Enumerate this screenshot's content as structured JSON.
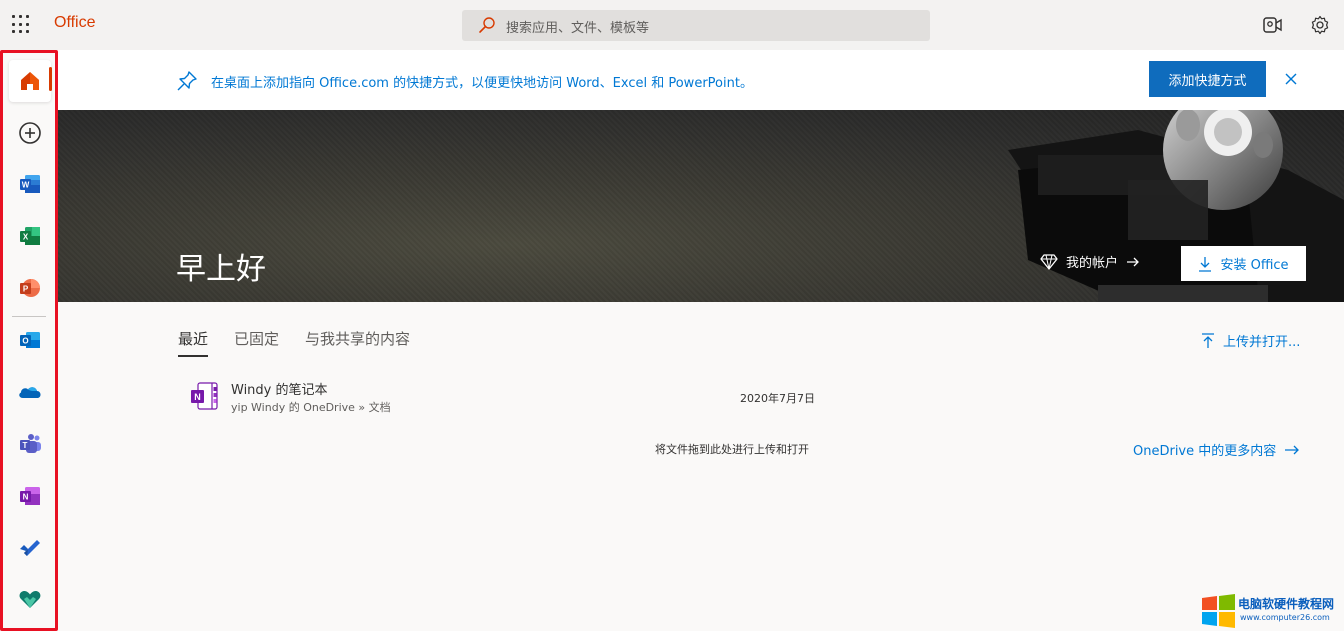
{
  "topbar": {
    "brand": "Office",
    "search_placeholder": "搜索应用、文件、模板等"
  },
  "sidebar": {
    "items": [
      {
        "name": "home-icon",
        "color": "#d83b01"
      },
      {
        "name": "create-icon",
        "color": "#323130"
      },
      {
        "name": "word-icon",
        "color": "#185abd"
      },
      {
        "name": "excel-icon",
        "color": "#107c41"
      },
      {
        "name": "powerpoint-icon",
        "color": "#c43e1c"
      },
      {
        "name": "outlook-icon",
        "color": "#0078d4"
      },
      {
        "name": "onedrive-icon",
        "color": "#0364b8"
      },
      {
        "name": "teams-icon",
        "color": "#5b5fc7"
      },
      {
        "name": "onenote-icon",
        "color": "#7719aa"
      },
      {
        "name": "todo-icon",
        "color": "#2564cf"
      },
      {
        "name": "family-safety-icon",
        "color": "#0f7b6c"
      }
    ],
    "highlight_color": "#e81123"
  },
  "banner": {
    "message": "在桌面上添加指向 Office.com 的快捷方式，以便更快地访问 Word、Excel 和 PowerPoint。",
    "button_label": "添加快捷方式"
  },
  "hero": {
    "greeting": "早上好",
    "account_label": "我的帐户",
    "install_label": "安装 Office"
  },
  "tabs": [
    {
      "label": "最近",
      "active": true
    },
    {
      "label": "已固定",
      "active": false
    },
    {
      "label": "与我共享的内容",
      "active": false
    }
  ],
  "upload_label": "上传并打开...",
  "files": [
    {
      "name": "Windy 的笔记本",
      "path": "yip Windy 的 OneDrive » 文档",
      "date": "2020年7月7日",
      "icon": "onenote-icon"
    }
  ],
  "drop_hint": "将文件拖到此处进行上传和打开",
  "more_link": "OneDrive 中的更多内容",
  "watermark": {
    "title": "电脑软硬件教程网",
    "url": "www.computer26.com"
  }
}
